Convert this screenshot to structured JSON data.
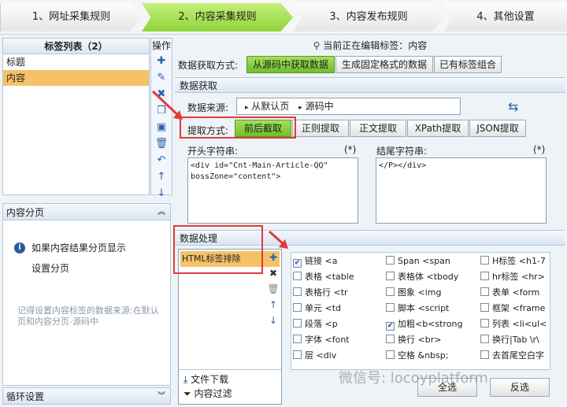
{
  "steps": [
    "1、网址采集规则",
    "2、内容采集规则",
    "3、内容发布规则",
    "4、其他设置"
  ],
  "left": {
    "title": "标签列表（2）",
    "items": [
      "标题",
      "内容"
    ],
    "ops_title": "操作",
    "paging_title": "内容分页",
    "paging_info": "如果内容结果分页显示",
    "paging_link": "设置分页",
    "paging_note": "记得设置内容标签的数据来源:在默认页和内容分页-源码中",
    "loop_title": "循环设置"
  },
  "editing": "当前正在编辑标签：内容",
  "fetch_mode": {
    "label": "数据获取方式:",
    "options": [
      "从源码中获取数据",
      "生成固定格式的数据",
      "已有标签组合"
    ]
  },
  "data_fetch": {
    "title": "数据获取",
    "source_label": "数据来源:",
    "source_path": [
      "从默认页",
      "源码中"
    ],
    "extract_label": "提取方式:",
    "extract_options": [
      "前后截取",
      "正则提取",
      "正文提取",
      "XPath提取",
      "JSON提取"
    ],
    "start_label": "开头字符串:",
    "start_value": "<div id=\"Cnt-Main-Article-QQ\"\nbossZone=\"content\">",
    "end_label": "结尾字符串:",
    "end_value": "</P></div>",
    "required": "(*)"
  },
  "processing": {
    "title": "数据处理",
    "list_item": "HTML标签排除",
    "file_download": "文件下载",
    "content_filter": "内容过滤",
    "select_all": "全选",
    "invert": "反选",
    "checkboxes": [
      [
        "链接 <a",
        "Span <span",
        "H标签 <h1-7"
      ],
      [
        "表格 <table",
        "表格体 <tbody",
        "hr标签 <hr>"
      ],
      [
        "表格行 <tr",
        "图象 <img",
        "表单 <form"
      ],
      [
        "单元 <td",
        "脚本 <script",
        "框架 <frame"
      ],
      [
        "段落 <p",
        "加粗<b<strong",
        "列表 <li<ul<"
      ],
      [
        "字体 <font",
        "换行 <br>",
        "换行|Tab \\r\\"
      ],
      [
        "层 <div",
        "空格 &nbsp;",
        "去首尾空白字"
      ]
    ],
    "checked": [
      [
        true,
        false,
        false
      ],
      [
        false,
        false,
        false
      ],
      [
        false,
        false,
        false
      ],
      [
        false,
        false,
        false
      ],
      [
        false,
        true,
        false
      ],
      [
        false,
        false,
        false
      ],
      [
        false,
        false,
        false
      ]
    ]
  },
  "watermark": "微信号: locoyplatform",
  "colors": {
    "active_green": "#8fd33a",
    "selected_orange": "#f5c26a",
    "highlight_red": "#e23a3a"
  }
}
